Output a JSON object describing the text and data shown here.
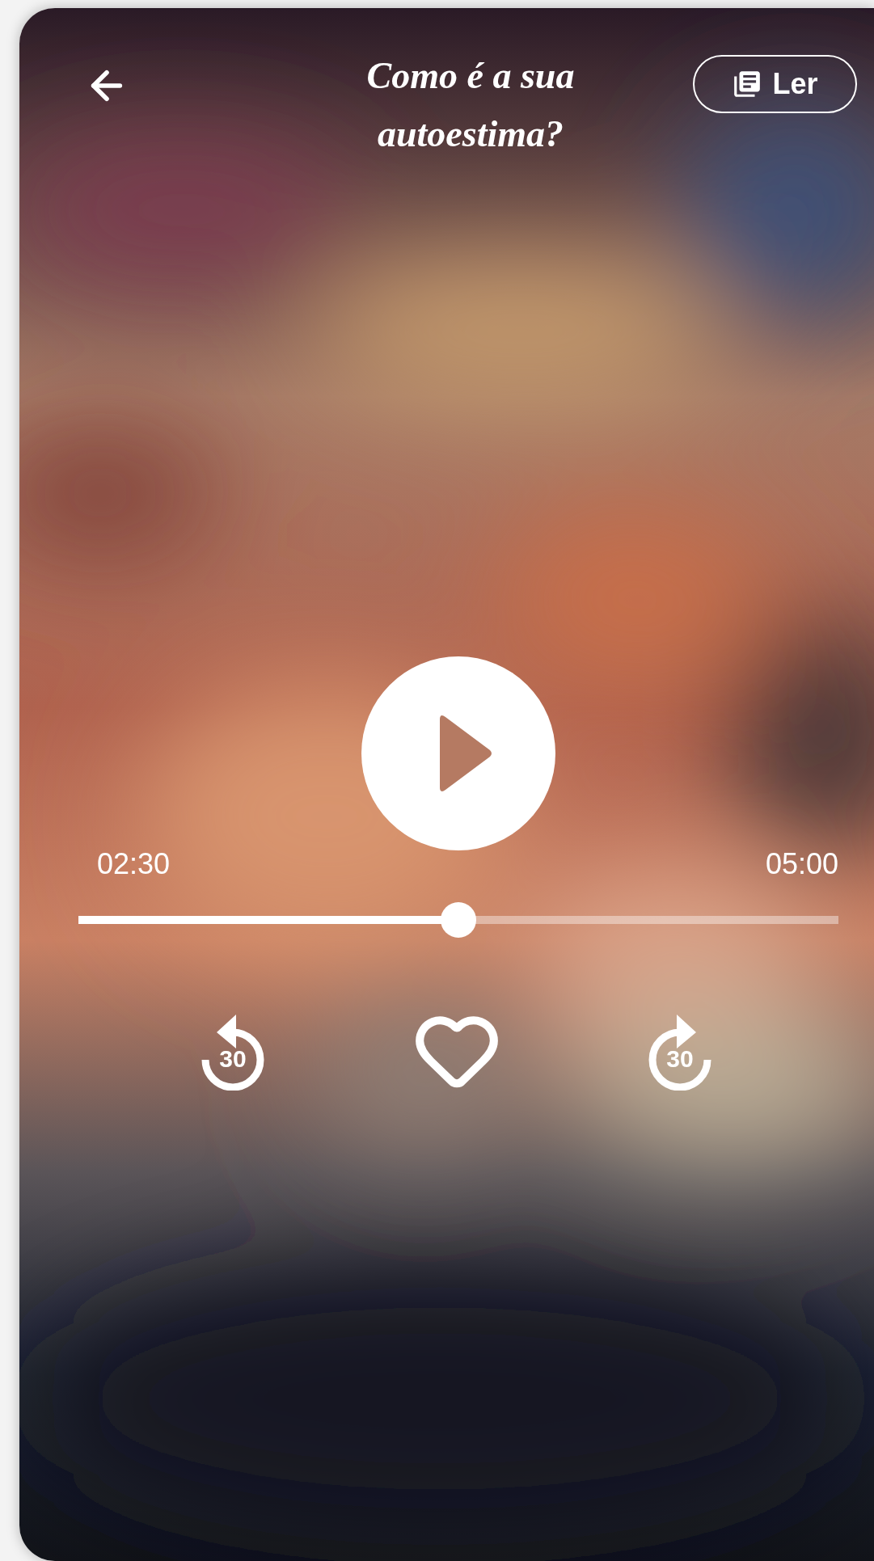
{
  "header": {
    "title": "Como é a sua autoestima?",
    "read_button": "Ler"
  },
  "player": {
    "playing": false,
    "elapsed": "02:30",
    "duration": "05:00",
    "level": 0.5
  },
  "controls": {
    "rewind_label": "30",
    "forward_label": "30",
    "favorite": false
  }
}
